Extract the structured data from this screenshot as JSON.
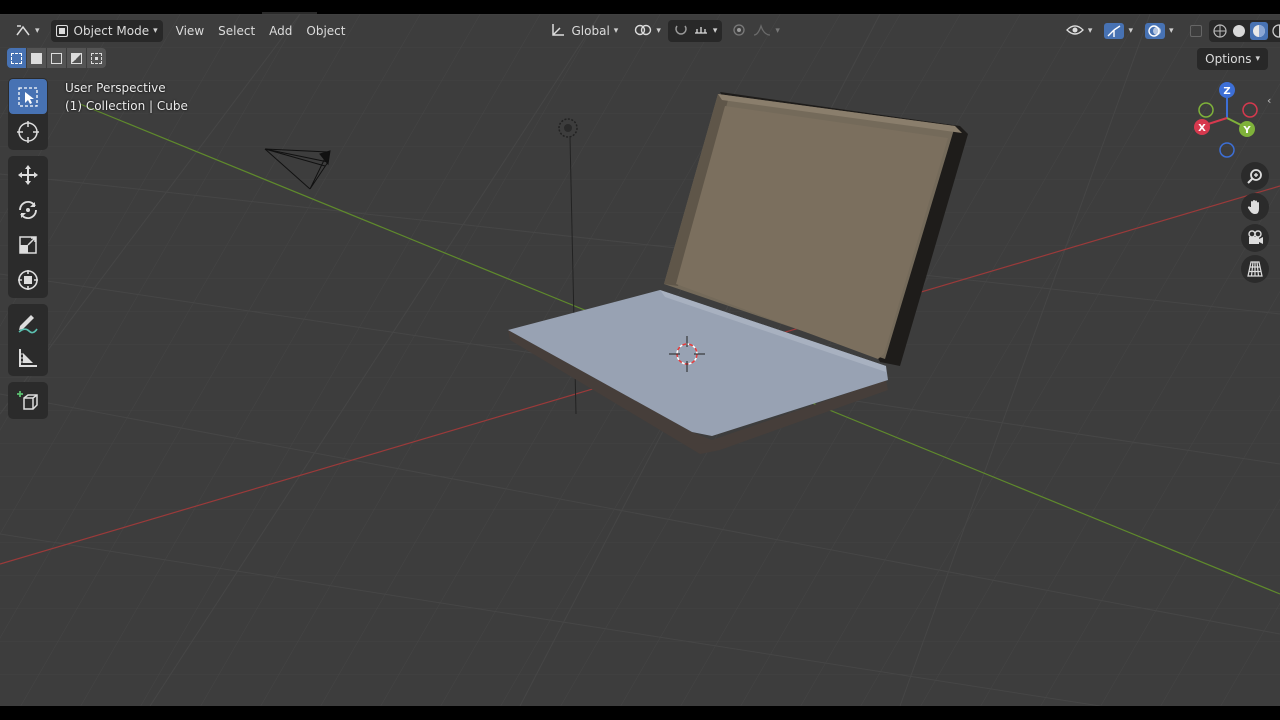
{
  "header": {
    "mode_label": "Object Mode",
    "menus": [
      "View",
      "Select",
      "Add",
      "Object"
    ],
    "transform_orientation": "Global",
    "options_label": "Options"
  },
  "viewport": {
    "perspective_label": "User Perspective",
    "collection_label": "(1) Collection | Cube"
  },
  "gizmo": {
    "z": "Z",
    "y": "Y",
    "x": "X"
  },
  "colors": {
    "background": "#3d3d3d",
    "header": "#282828",
    "active_tool": "#4772b3",
    "x_axis": "#b33a3a",
    "y_axis": "#6a9a2a",
    "laptop_base_top": "#98a2b3",
    "laptop_lid_screen": "#7b6f5e"
  },
  "icons": {
    "editor_type": "editor-type-icon",
    "object_mode": "object-mode-icon",
    "transform": "transform-orientation-icon",
    "pivot": "pivot-icon",
    "snap": "snap-icon",
    "proportional": "proportional-edit-icon",
    "visibility": "visibility-icon",
    "gizmo_toggle": "gizmo-toggle-icon",
    "overlay": "overlay-icon",
    "xray": "xray-icon",
    "shading": "shading-icon"
  }
}
